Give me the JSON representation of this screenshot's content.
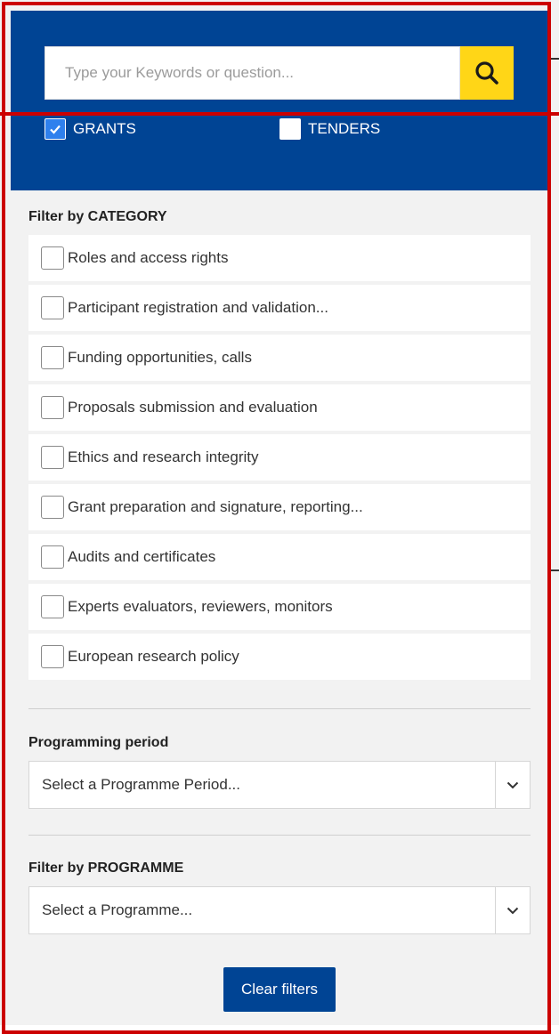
{
  "search": {
    "placeholder": "Type your Keywords or question..."
  },
  "type_filters": [
    {
      "label": "GRANTS",
      "checked": true
    },
    {
      "label": "TENDERS",
      "checked": false
    }
  ],
  "category": {
    "title": "Filter by CATEGORY",
    "items": [
      {
        "label": "Roles and access rights",
        "checked": false
      },
      {
        "label": "Participant registration and validation...",
        "checked": false
      },
      {
        "label": "Funding opportunities, calls",
        "checked": false
      },
      {
        "label": "Proposals submission and evaluation",
        "checked": false
      },
      {
        "label": "Ethics and research integrity",
        "checked": false
      },
      {
        "label": "Grant preparation and signature, reporting...",
        "checked": false
      },
      {
        "label": "Audits and certificates",
        "checked": false
      },
      {
        "label": "Experts evaluators, reviewers, monitors",
        "checked": false
      },
      {
        "label": "European research policy",
        "checked": false
      }
    ]
  },
  "programming_period": {
    "title": "Programming period",
    "selected": "Select a Programme Period..."
  },
  "programme": {
    "title": "Filter by PROGRAMME",
    "selected": "Select a Programme..."
  },
  "clear_button": {
    "label": "Clear filters"
  },
  "colors": {
    "header_blue": "#004494",
    "search_yellow": "#ffd617",
    "checkbox_blue": "#2f80ed",
    "panel_bg": "#f2f2f2",
    "annotation_red": "#cc0000"
  },
  "icons": {
    "search": "search-icon",
    "checkmark": "checkmark-icon",
    "dropdown": "chevron-down-icon"
  }
}
